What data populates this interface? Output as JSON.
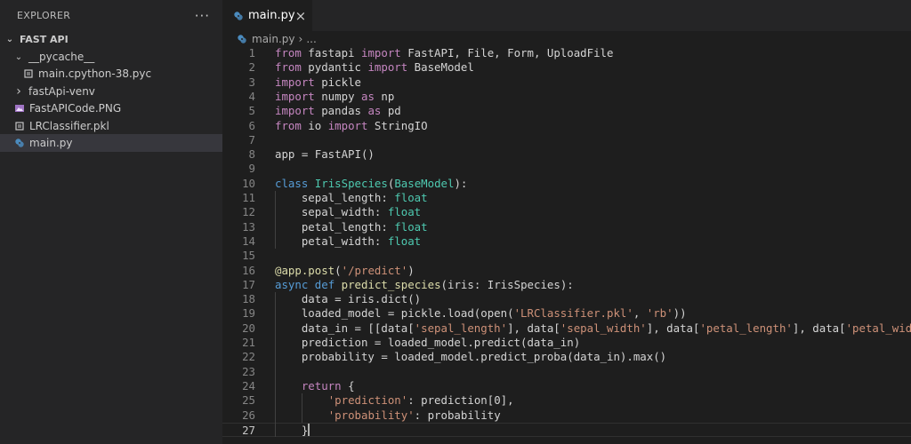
{
  "explorer": {
    "title": "EXPLORER",
    "more_label": "···",
    "root": "FAST API",
    "items": [
      {
        "label": "__pycache__",
        "type": "folder",
        "expanded": true,
        "depth": 1
      },
      {
        "label": "main.cpython-38.pyc",
        "type": "pyc",
        "depth": 2
      },
      {
        "label": "fastApi-venv",
        "type": "folder",
        "expanded": false,
        "depth": 1
      },
      {
        "label": "FastAPICode.PNG",
        "type": "image",
        "depth": 1
      },
      {
        "label": "LRClassifier.pkl",
        "type": "file",
        "depth": 1
      },
      {
        "label": "main.py",
        "type": "python",
        "depth": 1,
        "selected": true
      }
    ]
  },
  "tab": {
    "label": "main.py",
    "close": "×"
  },
  "breadcrumb": {
    "file": "main.py",
    "sep": "›",
    "rest": "..."
  },
  "editor": {
    "current_line": 27,
    "lines": [
      [
        [
          "kw",
          "from"
        ],
        [
          "t",
          " fastapi "
        ],
        [
          "kw",
          "import"
        ],
        [
          "t",
          " FastAPI, File, Form, UploadFile"
        ]
      ],
      [
        [
          "kw",
          "from"
        ],
        [
          "t",
          " pydantic "
        ],
        [
          "kw",
          "import"
        ],
        [
          "t",
          " BaseModel"
        ]
      ],
      [
        [
          "kw",
          "import"
        ],
        [
          "t",
          " pickle"
        ]
      ],
      [
        [
          "kw",
          "import"
        ],
        [
          "t",
          " numpy "
        ],
        [
          "kw",
          "as"
        ],
        [
          "t",
          " np"
        ]
      ],
      [
        [
          "kw",
          "import"
        ],
        [
          "t",
          " pandas "
        ],
        [
          "kw",
          "as"
        ],
        [
          "t",
          " pd"
        ]
      ],
      [
        [
          "kw",
          "from"
        ],
        [
          "t",
          " io "
        ],
        [
          "kw",
          "import"
        ],
        [
          "t",
          " StringIO"
        ]
      ],
      [],
      [
        [
          "t",
          "app = FastAPI()"
        ]
      ],
      [],
      [
        [
          "kb",
          "class"
        ],
        [
          "t",
          " "
        ],
        [
          "cls",
          "IrisSpecies"
        ],
        [
          "t",
          "("
        ],
        [
          "cls",
          "BaseModel"
        ],
        [
          "t",
          "):"
        ]
      ],
      [
        [
          "t",
          "    sepal_length: "
        ],
        [
          "cls",
          "float"
        ]
      ],
      [
        [
          "t",
          "    sepal_width: "
        ],
        [
          "cls",
          "float"
        ]
      ],
      [
        [
          "t",
          "    petal_length: "
        ],
        [
          "cls",
          "float"
        ]
      ],
      [
        [
          "t",
          "    petal_width: "
        ],
        [
          "cls",
          "float"
        ]
      ],
      [],
      [
        [
          "fn",
          "@app.post"
        ],
        [
          "t",
          "("
        ],
        [
          "str",
          "'/predict'"
        ],
        [
          "t",
          ")"
        ]
      ],
      [
        [
          "kb",
          "async"
        ],
        [
          "t",
          " "
        ],
        [
          "kb",
          "def"
        ],
        [
          "t",
          " "
        ],
        [
          "fn",
          "predict_species"
        ],
        [
          "t",
          "(iris: IrisSpecies):"
        ]
      ],
      [
        [
          "t",
          "    data = iris.dict()"
        ]
      ],
      [
        [
          "t",
          "    loaded_model = pickle.load(open("
        ],
        [
          "str",
          "'LRClassifier.pkl'"
        ],
        [
          "t",
          ", "
        ],
        [
          "str",
          "'rb'"
        ],
        [
          "t",
          "))"
        ]
      ],
      [
        [
          "t",
          "    data_in = [[data["
        ],
        [
          "str",
          "'sepal_length'"
        ],
        [
          "t",
          "], data["
        ],
        [
          "str",
          "'sepal_width'"
        ],
        [
          "t",
          "], data["
        ],
        [
          "str",
          "'petal_length'"
        ],
        [
          "t",
          "], data["
        ],
        [
          "str",
          "'petal_width'"
        ],
        [
          "t",
          "]]]"
        ]
      ],
      [
        [
          "t",
          "    prediction = loaded_model.predict(data_in)"
        ]
      ],
      [
        [
          "t",
          "    probability = loaded_model.predict_proba(data_in).max()"
        ]
      ],
      [],
      [
        [
          "t",
          "    "
        ],
        [
          "kw",
          "return"
        ],
        [
          "t",
          " {"
        ]
      ],
      [
        [
          "t",
          "        "
        ],
        [
          "str",
          "'prediction'"
        ],
        [
          "t",
          ": prediction[0],"
        ]
      ],
      [
        [
          "t",
          "        "
        ],
        [
          "str",
          "'probability'"
        ],
        [
          "t",
          ": probability"
        ]
      ],
      [
        [
          "t",
          "    }"
        ]
      ]
    ]
  }
}
